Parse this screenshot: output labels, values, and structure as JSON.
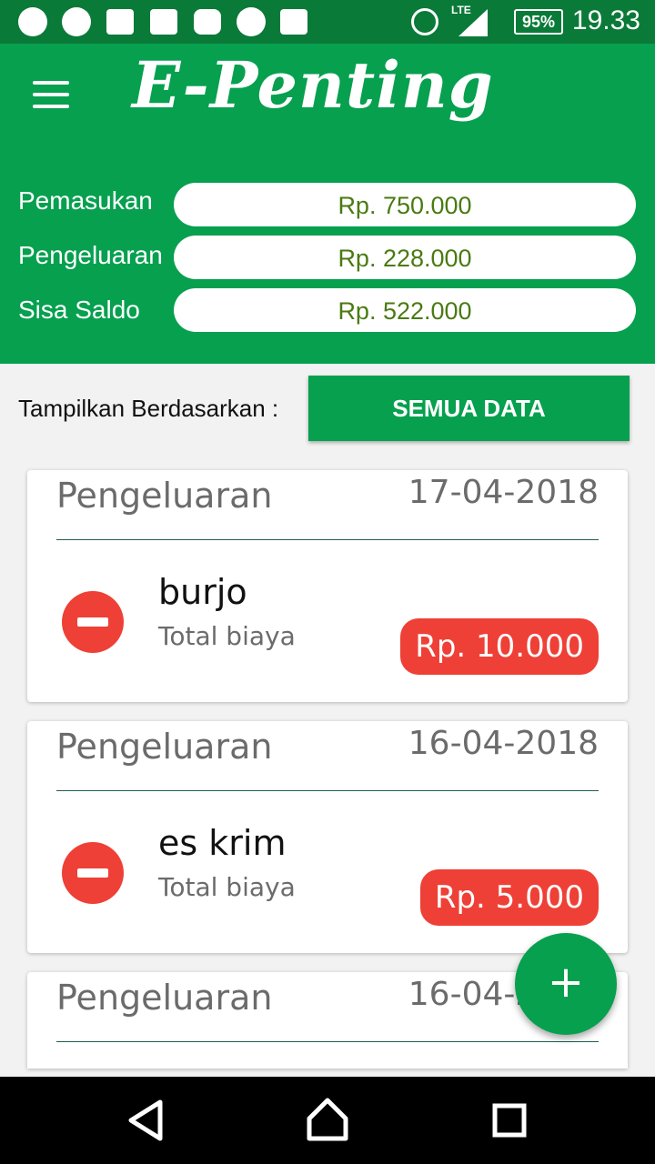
{
  "status_bar": {
    "battery": "95%",
    "network": "LTE",
    "time": "19.33"
  },
  "app": {
    "title": "E-Penting"
  },
  "summary": [
    {
      "label": "Pemasukan",
      "value": "Rp. 750.000"
    },
    {
      "label": "Pengeluaran",
      "value": "Rp. 228.000"
    },
    {
      "label": "Sisa Saldo",
      "value": "Rp. 522.000"
    }
  ],
  "filter": {
    "label": "Tampilkan Berdasarkan :",
    "button": "SEMUA DATA"
  },
  "transactions": [
    {
      "type": "Pengeluaran",
      "date": "17-04-2018",
      "name": "burjo",
      "subtitle": "Total biaya",
      "amount": "Rp. 10.000"
    },
    {
      "type": "Pengeluaran",
      "date": "16-04-2018",
      "name": "es krim",
      "subtitle": "Total biaya",
      "amount": "Rp. 5.000"
    },
    {
      "type": "Pengeluaran",
      "date": "16-04-2018",
      "name": "",
      "subtitle": "",
      "amount": ""
    }
  ],
  "fab": {
    "label": "+"
  },
  "colors": {
    "primary": "#06a04f",
    "status_bar": "#0a7a38",
    "expense": "#ee4036",
    "amount_text": "#4a7a12"
  }
}
